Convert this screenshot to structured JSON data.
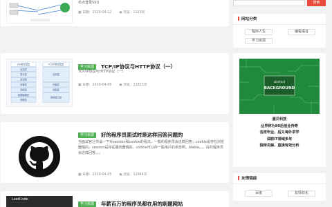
{
  "articles": [
    {
      "title": "",
      "excerpt": "单点登录SSO",
      "date": "日期：2020-04-12",
      "views": "浏览：1223次"
    },
    {
      "tag": "学习资源",
      "title": "TCP/IP协议与HTTP协议（一）",
      "excerpt": "TCP/IP协议与HTTP协议（一）",
      "date": "日期：2020-04-06",
      "views": "浏览：11823次",
      "thumb_left": [
        "OSI参考模型",
        "应用层",
        "表示层",
        "会话层",
        "传输层",
        "网络层",
        "数据链路层",
        "物理层"
      ],
      "thumb_right": [
        "TCP/IP参考模型",
        "应用层",
        "传输层",
        "网络层",
        "网络接口层"
      ]
    },
    {
      "tag": "学习资源",
      "title": "好的程序员面试时是这样回答问题的",
      "excerpt": "当面试官让你谈一下对session和cookie的看法，一般的程序员会这样回答。cookie是存在浏览器端的，session是存在服务器端的。cookie可以存一些用户的状态啊，blabla。。。好的程序员会这样回答。。。",
      "date": "日期：2020-04-05",
      "views": "浏览：12964次"
    },
    {
      "tag": "学习资源",
      "title": "年薪百万的程序员都在用的刷题网站",
      "thumb_text": "LeetCode"
    }
  ],
  "search": {
    "button_label": "搜索"
  },
  "categories_widget": {
    "title": "网站分类",
    "items": [
      "程序人生",
      "编程语言",
      "学习资源"
    ]
  },
  "promo": {
    "image_words": [
      "abstract",
      "BACKGROUND"
    ],
    "lines": [
      "嘉贝科技",
      "业界称为80后创业传奇",
      "名校毕业，后又海外求学",
      "深耕IT领域多年",
      "独特见解，直接有效分析"
    ]
  },
  "links_widget": {
    "title": "友情链接",
    "items": [
      "百度",
      "友情石化"
    ]
  },
  "colors": {
    "tag": "#4caf50",
    "accent": "#e74c3c",
    "promo_bg": "#1f8a3a"
  }
}
